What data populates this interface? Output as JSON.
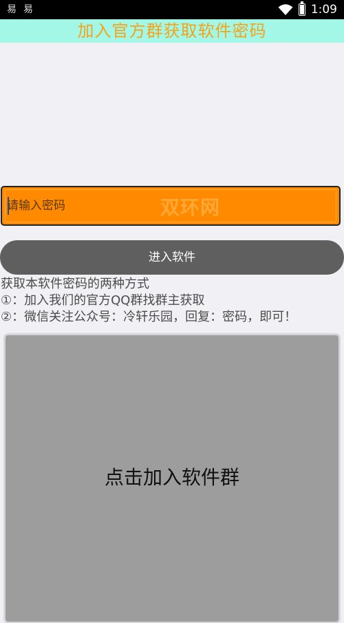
{
  "status_bar": {
    "time": "1:09",
    "notification_icons": [
      "易",
      "易"
    ],
    "wifi_icon": "wifi-icon",
    "battery_icon": "battery-icon",
    "battery_level": 0.9
  },
  "header": {
    "title": "加入官方群获取软件密码",
    "bg_color": "#a3f7e6",
    "title_color": "#f6a31c"
  },
  "password": {
    "placeholder": "请输入密码",
    "value": "",
    "watermark": "双环网",
    "bg_color": "#ff8a00"
  },
  "enter_button": {
    "label": "进入软件",
    "bg_color": "#5f5f5f"
  },
  "instructions": {
    "heading": "获取本软件密码的两种方式",
    "line1": "①：加入我们的官方QQ群找群主获取",
    "line2": "②：微信关注公众号：冷轩乐园，回复：密码，即可！"
  },
  "join_group_card": {
    "label": "点击加入软件群",
    "bg_color": "#9d9d9d"
  }
}
